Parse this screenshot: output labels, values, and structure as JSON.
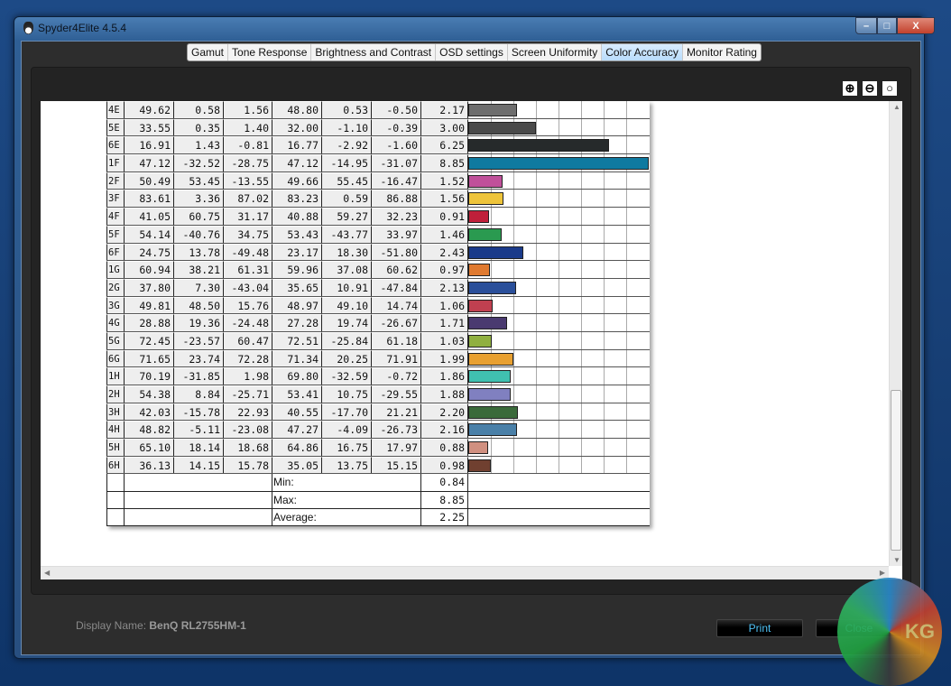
{
  "window": {
    "title": "Spyder4Elite 4.5.4"
  },
  "tabs": [
    "Gamut",
    "Tone Response",
    "Brightness and Contrast",
    "OSD settings",
    "Screen Uniformity",
    "Color Accuracy",
    "Monitor Rating"
  ],
  "active_tab": "Color Accuracy",
  "table": {
    "rows": [
      {
        "id": "4E",
        "v": [
          "49.62",
          "0.58",
          "1.56",
          "48.80",
          "0.53",
          "-0.50"
        ],
        "de": "2.17",
        "de_value": 2.17,
        "color": "#6e6e6e"
      },
      {
        "id": "5E",
        "v": [
          "33.55",
          "0.35",
          "1.40",
          "32.00",
          "-1.10",
          "-0.39"
        ],
        "de": "3.00",
        "de_value": 3.0,
        "color": "#4a4a4a"
      },
      {
        "id": "6E",
        "v": [
          "16.91",
          "1.43",
          "-0.81",
          "16.77",
          "-2.92",
          "-1.60"
        ],
        "de": "6.25",
        "de_value": 6.25,
        "color": "#262a2b"
      },
      {
        "id": "1F",
        "v": [
          "47.12",
          "-32.52",
          "-28.75",
          "47.12",
          "-14.95",
          "-31.07"
        ],
        "de": "8.85",
        "de_value": 8.85,
        "color": "#0f7aa0"
      },
      {
        "id": "2F",
        "v": [
          "50.49",
          "53.45",
          "-13.55",
          "49.66",
          "55.45",
          "-16.47"
        ],
        "de": "1.52",
        "de_value": 1.52,
        "color": "#c0509a"
      },
      {
        "id": "3F",
        "v": [
          "83.61",
          "3.36",
          "87.02",
          "83.23",
          "0.59",
          "86.88"
        ],
        "de": "1.56",
        "de_value": 1.56,
        "color": "#eec43a"
      },
      {
        "id": "4F",
        "v": [
          "41.05",
          "60.75",
          "31.17",
          "40.88",
          "59.27",
          "32.23"
        ],
        "de": "0.91",
        "de_value": 0.91,
        "color": "#c0203a"
      },
      {
        "id": "5F",
        "v": [
          "54.14",
          "-40.76",
          "34.75",
          "53.43",
          "-43.77",
          "33.97"
        ],
        "de": "1.46",
        "de_value": 1.46,
        "color": "#2a9a50"
      },
      {
        "id": "6F",
        "v": [
          "24.75",
          "13.78",
          "-49.48",
          "23.17",
          "18.30",
          "-51.80"
        ],
        "de": "2.43",
        "de_value": 2.43,
        "color": "#1a3a8a"
      },
      {
        "id": "1G",
        "v": [
          "60.94",
          "38.21",
          "61.31",
          "59.96",
          "37.08",
          "60.62"
        ],
        "de": "0.97",
        "de_value": 0.97,
        "color": "#e07a30"
      },
      {
        "id": "2G",
        "v": [
          "37.80",
          "7.30",
          "-43.04",
          "35.65",
          "10.91",
          "-47.84"
        ],
        "de": "2.13",
        "de_value": 2.13,
        "color": "#2a4f9a"
      },
      {
        "id": "3G",
        "v": [
          "49.81",
          "48.50",
          "15.76",
          "48.97",
          "49.10",
          "14.74"
        ],
        "de": "1.06",
        "de_value": 1.06,
        "color": "#c04050"
      },
      {
        "id": "4G",
        "v": [
          "28.88",
          "19.36",
          "-24.48",
          "27.28",
          "19.74",
          "-26.67"
        ],
        "de": "1.71",
        "de_value": 1.71,
        "color": "#4a3a70"
      },
      {
        "id": "5G",
        "v": [
          "72.45",
          "-23.57",
          "60.47",
          "72.51",
          "-25.84",
          "61.18"
        ],
        "de": "1.03",
        "de_value": 1.03,
        "color": "#90b040"
      },
      {
        "id": "6G",
        "v": [
          "71.65",
          "23.74",
          "72.28",
          "71.34",
          "20.25",
          "71.91"
        ],
        "de": "1.99",
        "de_value": 1.99,
        "color": "#e8a030"
      },
      {
        "id": "1H",
        "v": [
          "70.19",
          "-31.85",
          "1.98",
          "69.80",
          "-32.59",
          "-0.72"
        ],
        "de": "1.86",
        "de_value": 1.86,
        "color": "#40c0b0"
      },
      {
        "id": "2H",
        "v": [
          "54.38",
          "8.84",
          "-25.71",
          "53.41",
          "10.75",
          "-29.55"
        ],
        "de": "1.88",
        "de_value": 1.88,
        "color": "#8080c0"
      },
      {
        "id": "3H",
        "v": [
          "42.03",
          "-15.78",
          "22.93",
          "40.55",
          "-17.70",
          "21.21"
        ],
        "de": "2.20",
        "de_value": 2.2,
        "color": "#3a6a3a"
      },
      {
        "id": "4H",
        "v": [
          "48.82",
          "-5.11",
          "-23.08",
          "47.27",
          "-4.09",
          "-26.73"
        ],
        "de": "2.16",
        "de_value": 2.16,
        "color": "#4a80a8"
      },
      {
        "id": "5H",
        "v": [
          "65.10",
          "18.14",
          "18.68",
          "64.86",
          "16.75",
          "17.97"
        ],
        "de": "0.88",
        "de_value": 0.88,
        "color": "#d09080"
      },
      {
        "id": "6H",
        "v": [
          "36.13",
          "14.15",
          "15.78",
          "35.05",
          "13.75",
          "15.15"
        ],
        "de": "0.98",
        "de_value": 0.98,
        "color": "#704030"
      }
    ],
    "summary": [
      {
        "label": "Min:",
        "value": "0.84"
      },
      {
        "label": "Max:",
        "value": "8.85"
      },
      {
        "label": "Average:",
        "value": "2.25"
      }
    ],
    "bar_max": 8
  },
  "footer": {
    "display_label": "Display Name:",
    "display_name": "BenQ RL2755HM-1",
    "print": "Print",
    "close": "Close"
  },
  "logo": "KG"
}
